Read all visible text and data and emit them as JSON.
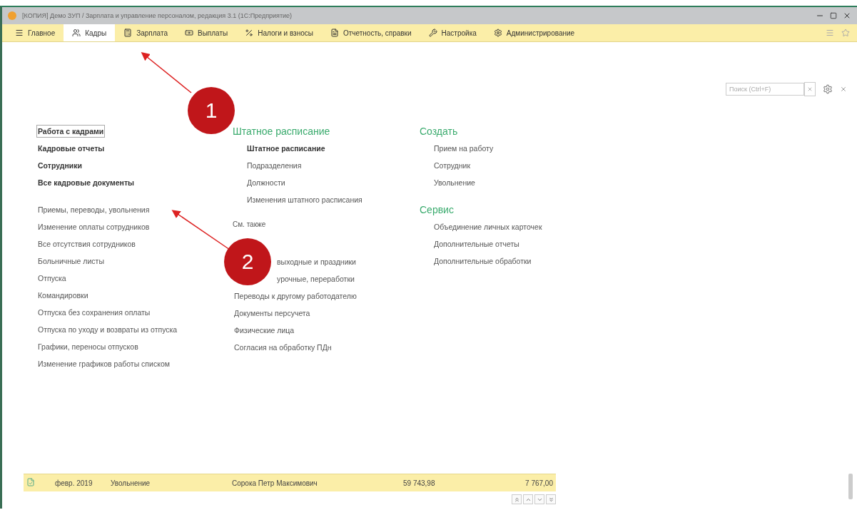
{
  "window": {
    "title": "[КОПИЯ] Демо ЗУП / Зарплата и управление персоналом, редакция 3.1 (1С:Предприятие)"
  },
  "sections": [
    {
      "label": "Главное",
      "selected": false
    },
    {
      "label": "Кадры",
      "selected": true
    },
    {
      "label": "Зарплата",
      "selected": false
    },
    {
      "label": "Выплаты",
      "selected": false
    },
    {
      "label": "Налоги и взносы",
      "selected": false
    },
    {
      "label": "Отчетность, справки",
      "selected": false
    },
    {
      "label": "Настройка",
      "selected": false
    },
    {
      "label": "Администрирование",
      "selected": false
    }
  ],
  "search": {
    "placeholder": "Поиск (Ctrl+F)"
  },
  "columns": [
    {
      "groups": [
        {
          "items": [
            {
              "label": "Работа с кадрами",
              "bold": true,
              "focused": true
            },
            {
              "label": "Кадровые отчеты",
              "bold": true,
              "focused": false
            },
            {
              "label": "Сотрудники",
              "bold": true,
              "focused": false
            },
            {
              "label": "Все кадровые документы",
              "bold": true,
              "focused": false
            }
          ]
        },
        {
          "items": [
            {
              "label": "Приемы, переводы, увольнения",
              "bold": false,
              "focused": false
            },
            {
              "label": "Изменение оплаты сотрудников",
              "bold": false,
              "focused": false
            },
            {
              "label": "Все отсутствия сотрудников",
              "bold": false,
              "focused": false
            },
            {
              "label": "Больничные листы",
              "bold": false,
              "focused": false
            },
            {
              "label": "Отпуска",
              "bold": false,
              "focused": false
            },
            {
              "label": "Командировки",
              "bold": false,
              "focused": false
            },
            {
              "label": "Отпуска без сохранения оплаты",
              "bold": false,
              "focused": false
            },
            {
              "label": "Отпуска по уходу и возвраты из отпуска",
              "bold": false,
              "focused": false
            },
            {
              "label": "Графики, переносы отпусков",
              "bold": false,
              "focused": false
            },
            {
              "label": "Изменение графиков работы списком",
              "bold": false,
              "focused": false
            }
          ]
        }
      ]
    },
    {
      "groups": [
        {
          "title": "Штатное расписание",
          "items": [
            {
              "label": "Штатное расписание",
              "bold": true,
              "focused": false
            },
            {
              "label": "Подразделения",
              "bold": false,
              "focused": false
            },
            {
              "label": "Должности",
              "bold": false,
              "focused": false
            },
            {
              "label": "Изменения штатного расписания",
              "bold": false,
              "focused": false
            }
          ]
        },
        {
          "subtitle": "См. также",
          "items": [
            {
              "label": "выходные и праздники",
              "bold": false,
              "focused": false,
              "partial": true
            },
            {
              "label": "урочные, переработки",
              "bold": false,
              "focused": false,
              "partial": true
            },
            {
              "label": "Переводы к другому работодателю",
              "bold": false,
              "focused": false
            },
            {
              "label": "Документы персучета",
              "bold": false,
              "focused": false
            },
            {
              "label": "Физические лица",
              "bold": false,
              "focused": false
            },
            {
              "label": "Согласия на обработку ПДн",
              "bold": false,
              "focused": false
            }
          ]
        }
      ]
    },
    {
      "groups": [
        {
          "title": "Создать",
          "items": [
            {
              "label": "Прием на работу",
              "bold": false,
              "focused": false
            },
            {
              "label": "Сотрудник",
              "bold": false,
              "focused": false
            },
            {
              "label": "Увольнение",
              "bold": false,
              "focused": false
            }
          ]
        },
        {
          "title": "Сервис",
          "items": [
            {
              "label": "Объединение личных карточек",
              "bold": false,
              "focused": false
            },
            {
              "label": "Дополнительные отчеты",
              "bold": false,
              "focused": false
            },
            {
              "label": "Дополнительные обработки",
              "bold": false,
              "focused": false
            }
          ]
        }
      ]
    }
  ],
  "bottom_row": {
    "period": "февр. 2019",
    "document": "Увольнение",
    "employee": "Сорока Петр Максимович",
    "amount": "59 743,98",
    "tax": "7 767,00"
  },
  "annotations": [
    {
      "number": "1"
    },
    {
      "number": "2"
    }
  ]
}
